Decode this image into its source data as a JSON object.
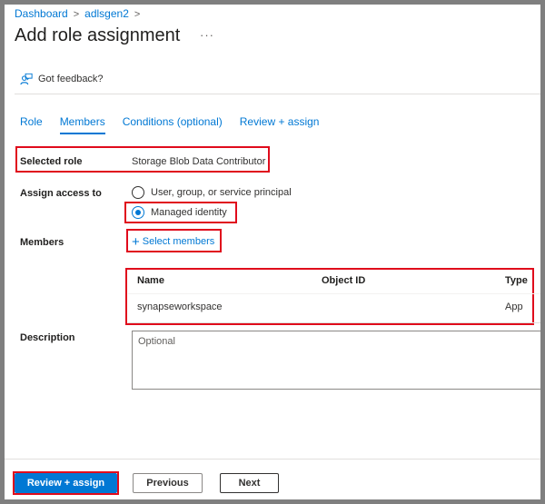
{
  "breadcrumb": [
    "Dashboard",
    "adlsgen2"
  ],
  "header": {
    "title": "Add role assignment",
    "more_label": "···"
  },
  "feedback": {
    "label": "Got feedback?",
    "icon": "feedback-person-icon"
  },
  "tabs": [
    {
      "label": "Role",
      "active": false
    },
    {
      "label": "Members",
      "active": true
    },
    {
      "label": "Conditions (optional)",
      "active": false
    },
    {
      "label": "Review + assign",
      "active": false
    }
  ],
  "form": {
    "selected_role_label": "Selected role",
    "selected_role_value": "Storage Blob Data Contributor",
    "assign_access_label": "Assign access to",
    "assign_access_options": [
      {
        "label": "User, group, or service principal",
        "checked": false
      },
      {
        "label": "Managed identity",
        "checked": true
      }
    ],
    "members_label": "Members",
    "select_members_label": "Select members",
    "description_label": "Description",
    "description_placeholder": "Optional"
  },
  "members_table": {
    "columns": [
      "Name",
      "Object ID",
      "Type"
    ],
    "rows": [
      {
        "name": "synapseworkspace",
        "object_id": "",
        "type": "App"
      }
    ]
  },
  "footer": {
    "review_assign_label": "Review + assign",
    "previous_label": "Previous",
    "next_label": "Next"
  },
  "colors": {
    "accent": "#0078d4",
    "highlight": "#e00b1c",
    "frame": "#7f7f7f"
  }
}
